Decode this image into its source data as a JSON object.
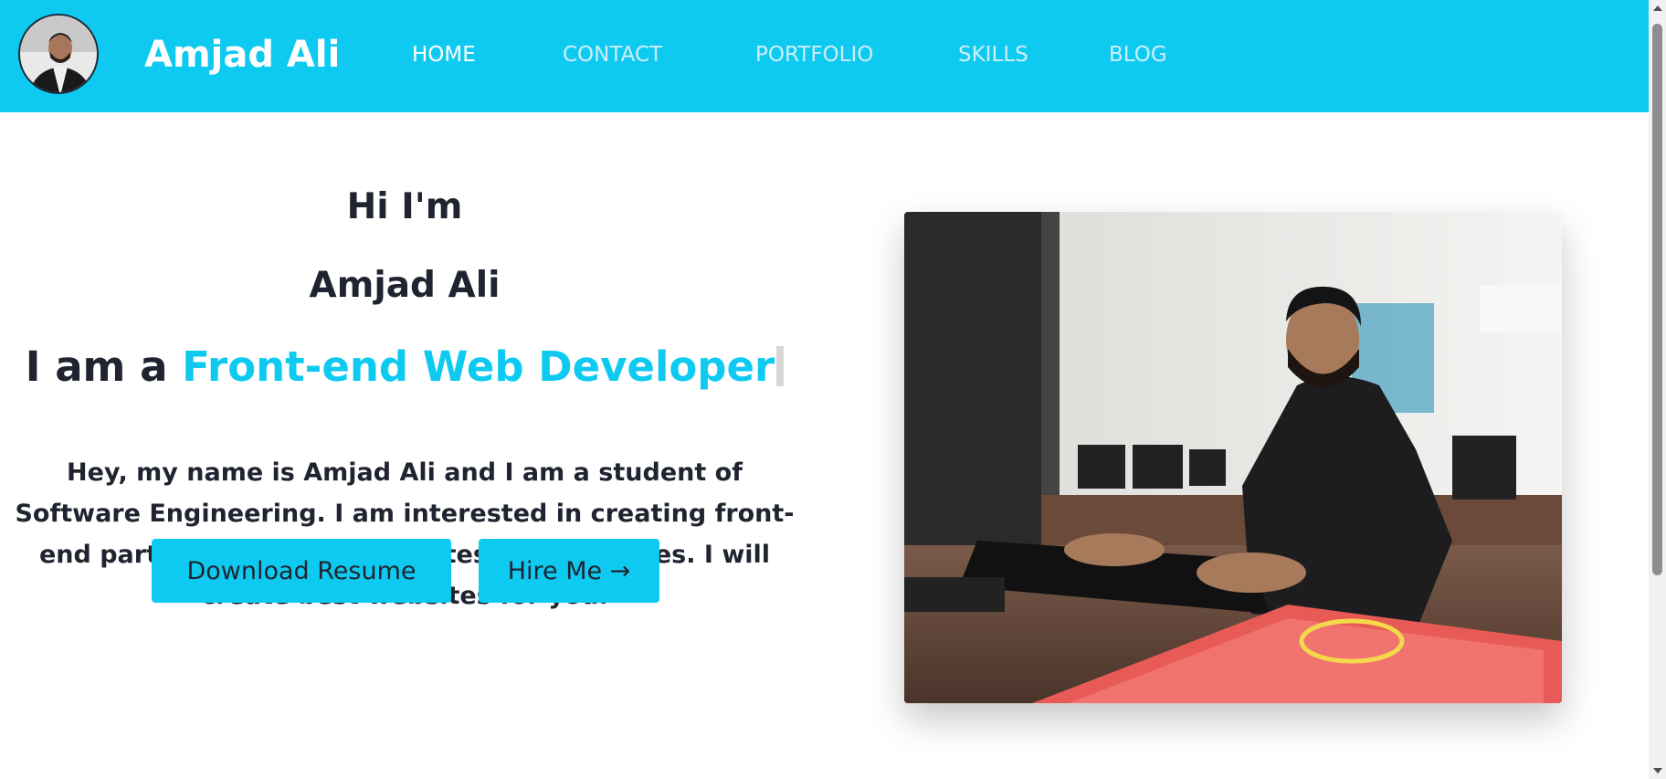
{
  "header": {
    "brand": "Amjad Ali",
    "nav": [
      {
        "label": "HOME",
        "active": true
      },
      {
        "label": "CONTACT",
        "active": false
      },
      {
        "label": "PORTFOLIO",
        "active": false
      },
      {
        "label": "SKILLS",
        "active": false
      },
      {
        "label": "BLOG",
        "active": false
      }
    ]
  },
  "hero": {
    "greeting": "Hi I'm",
    "name": "Amjad Ali",
    "role_prefix": "I am a",
    "role": "Front-end Web Developer",
    "intro": "Hey, my name is Amjad Ali and I am a student of Software Engineering. I am interested in creating front-end part of websites using latest technologies. I will create best websites for you.",
    "buttons": {
      "resume": "Download Resume",
      "hire": "Hire Me →"
    }
  },
  "colors": {
    "accent": "#0fcaf0",
    "text": "#1f2430",
    "nav_inactive": "#cdeef8"
  },
  "icons": {
    "avatar": "profile-photo",
    "hero_photo": "developer-at-keyboard-photo"
  }
}
